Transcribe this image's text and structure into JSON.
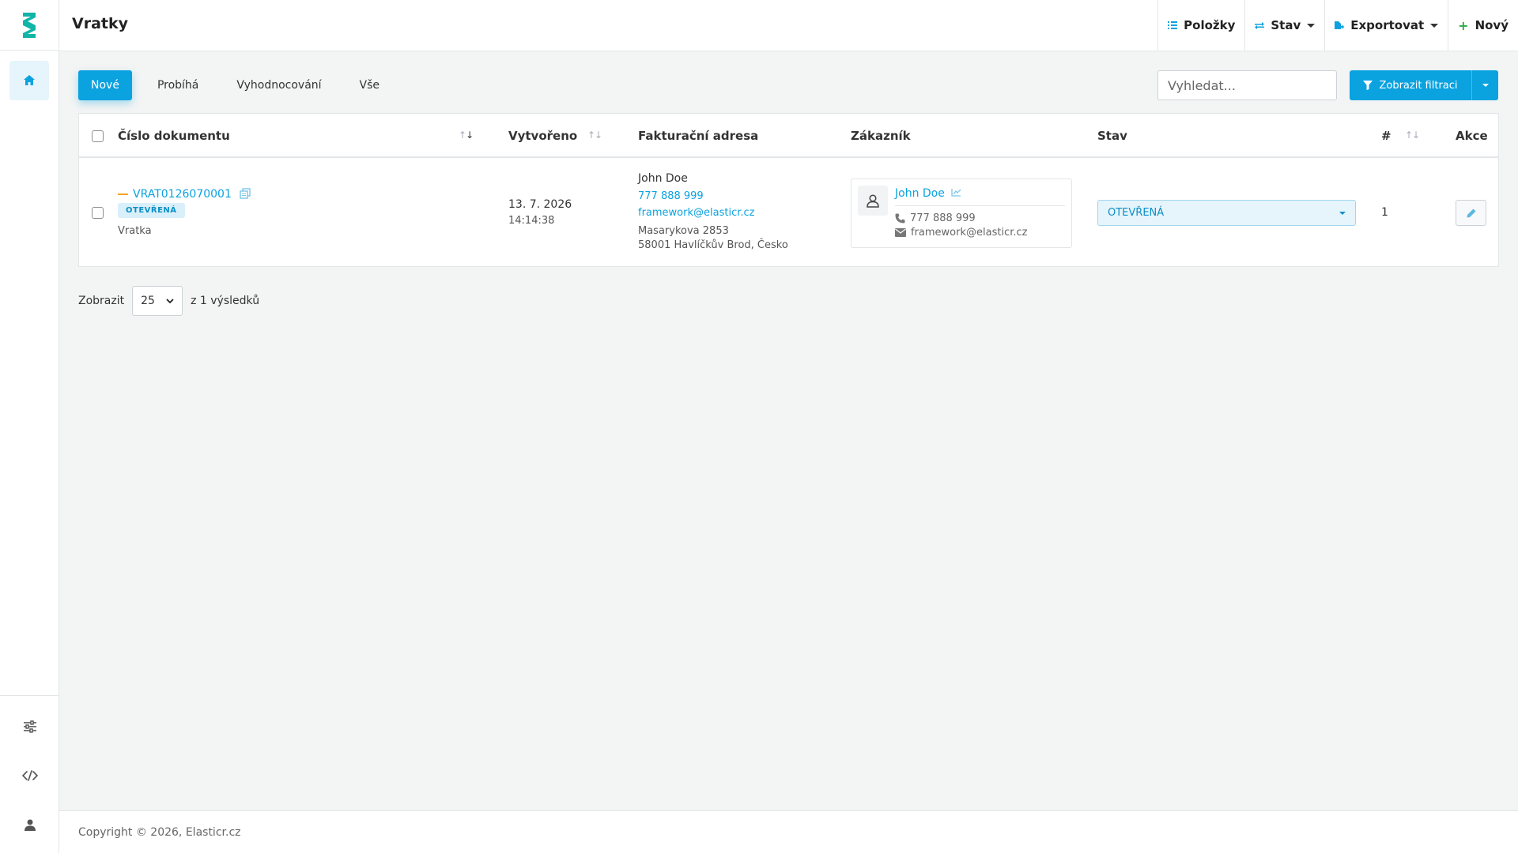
{
  "app": {
    "page_title": "Vratky"
  },
  "toolbar": {
    "items_label": "Položky",
    "status_label": "Stav",
    "export_label": "Exportovat",
    "new_label": "Nový"
  },
  "tabs": [
    {
      "label": "Nové",
      "active": true
    },
    {
      "label": "Probíhá",
      "active": false
    },
    {
      "label": "Vyhodnocování",
      "active": false
    },
    {
      "label": "Vše",
      "active": false
    }
  ],
  "search": {
    "placeholder": "Vyhledat..."
  },
  "filter": {
    "label": "Zobrazit filtraci"
  },
  "table": {
    "headers": {
      "document_number": "Číslo dokumentu",
      "created": "Vytvořeno",
      "billing_address": "Fakturační adresa",
      "customer": "Zákazník",
      "status": "Stav",
      "count": "#",
      "actions": "Akce"
    },
    "rows": [
      {
        "document_number": "VRAT0126070001",
        "status_badge": "OTEVŘENÁ",
        "doc_type": "Vratka",
        "created_date": "13. 7. 2026",
        "created_time": "14:14:38",
        "billing_name": "John Doe",
        "billing_phone": "777 888 999",
        "billing_email": "framework@elasticr.cz",
        "billing_street": "Masarykova 2853",
        "billing_city": "58001 Havlíčkův Brod, Česko",
        "customer_name": "John Doe",
        "customer_phone": "777 888 999",
        "customer_email": "framework@elasticr.cz",
        "status_select": "OTEVŘENÁ",
        "count": "1"
      }
    ]
  },
  "pagination": {
    "show_label": "Zobrazit",
    "page_size": "25",
    "results_label": "z 1 výsledků"
  },
  "footer": {
    "copyright": "Copyright © 2026, Elasticr.cz"
  },
  "colors": {
    "accent": "#0ba2e0",
    "warning": "#f5a623",
    "badge_bg": "#d9f0fb"
  }
}
